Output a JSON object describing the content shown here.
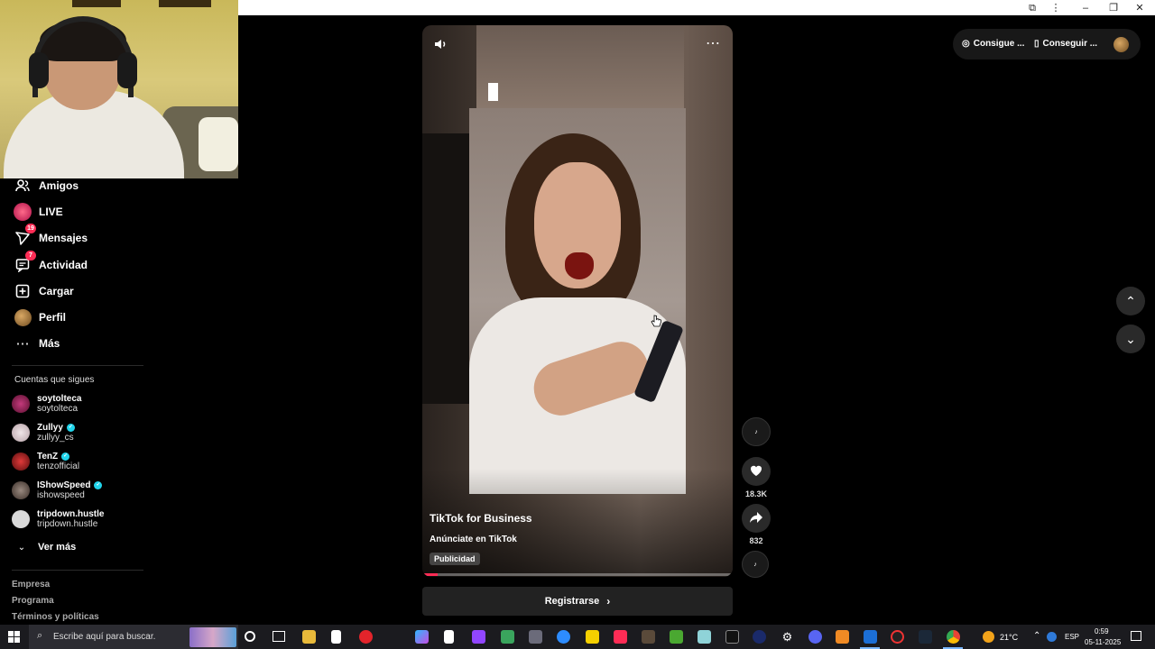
{
  "colors": {
    "accent": "#fe2c55",
    "verified": "#20d5ec",
    "background": "#000000"
  },
  "browser": {
    "icons": [
      "extensions-icon",
      "kebab-menu-icon",
      "minimize-icon",
      "restore-icon",
      "close-icon"
    ]
  },
  "sidebar": {
    "nav": [
      {
        "label": "Amigos",
        "icon": "friends-icon"
      },
      {
        "label": "LIVE",
        "icon": "live-icon"
      },
      {
        "label": "Mensajes",
        "icon": "messages-icon",
        "badge": "19"
      },
      {
        "label": "Actividad",
        "icon": "activity-icon",
        "badge": "7"
      },
      {
        "label": "Cargar",
        "icon": "upload-icon"
      },
      {
        "label": "Perfil",
        "icon": "profile-avatar"
      },
      {
        "label": "Más",
        "icon": "more-icon"
      }
    ],
    "following_title": "Cuentas que sigues",
    "following": [
      {
        "name": "soytolteca",
        "handle": "soytolteca",
        "verified": false
      },
      {
        "name": "Zullyy",
        "handle": "zullyy_cs",
        "verified": true
      },
      {
        "name": "TenZ",
        "handle": "tenzofficial",
        "verified": true
      },
      {
        "name": "IShowSpeed",
        "handle": "ishowspeed",
        "verified": true
      },
      {
        "name": "tripdown.hustle",
        "handle": "tripdown.hustle",
        "verified": false
      }
    ],
    "see_more": "Ver más",
    "footer": [
      "Empresa",
      "Programa",
      "Términos y políticas"
    ]
  },
  "video": {
    "advertiser": "TikTok for Business",
    "description": "Anúnciate en TikTok",
    "tag": "Publicidad",
    "progress": 0.05,
    "cta": "Registrarse"
  },
  "actions": {
    "likes": "18.3K",
    "shares": "832"
  },
  "topright": {
    "coins": "Consigue ...",
    "app": "Conseguir ..."
  },
  "taskbar": {
    "search_placeholder": "Escribe aquí para buscar.",
    "weather": "21°C",
    "language": "ESP",
    "time": "0:59",
    "date": "05-11-2025"
  }
}
